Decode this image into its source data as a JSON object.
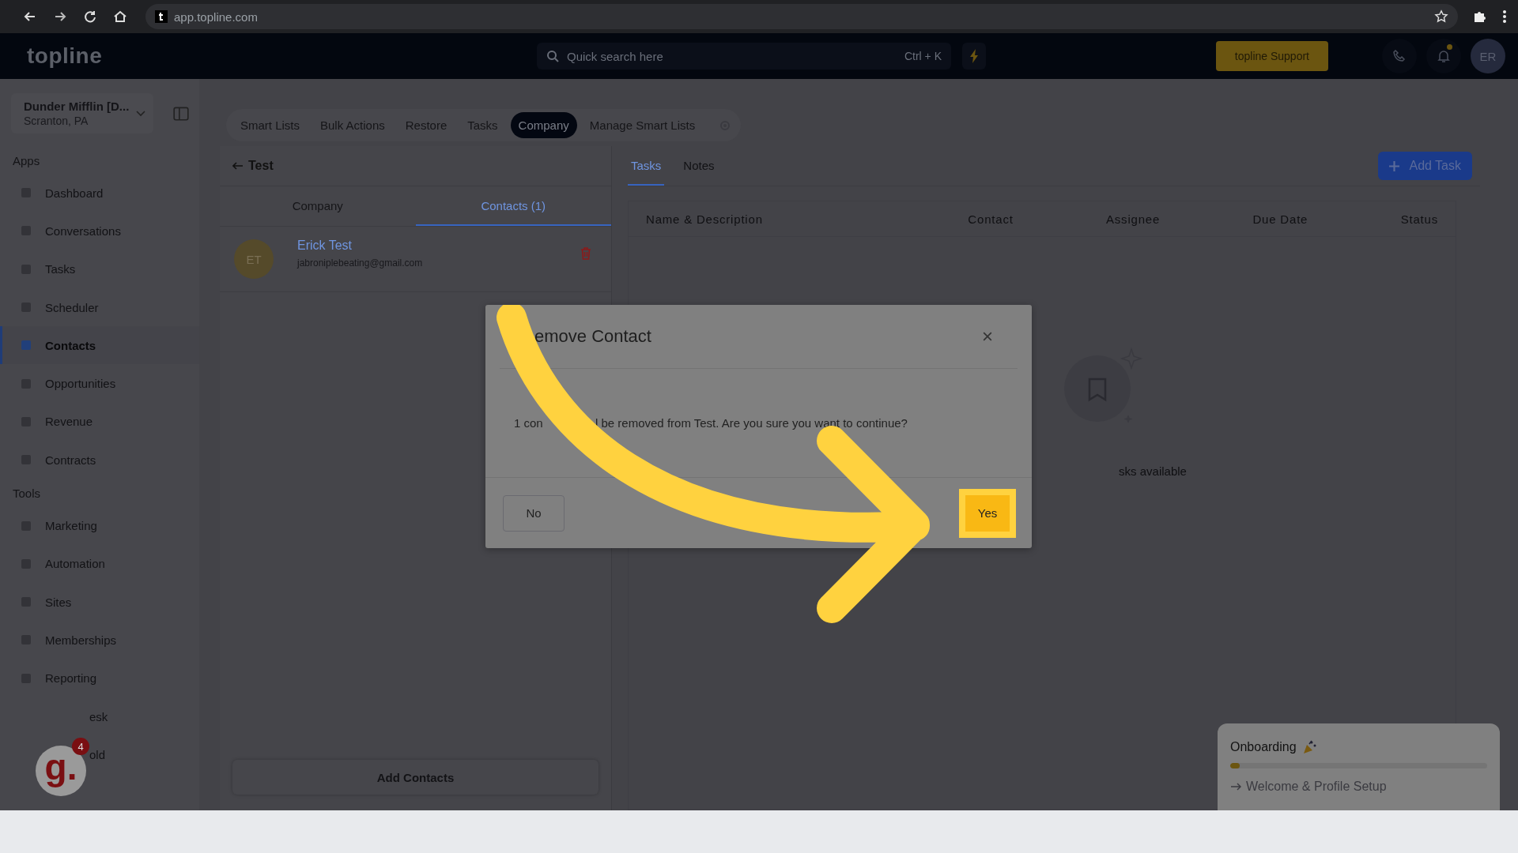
{
  "browser": {
    "url": "app.topline.com"
  },
  "header": {
    "logo": "topline",
    "search": {
      "placeholder": "Quick search here",
      "shortcut": "Ctrl + K"
    },
    "support_button": "topline Support",
    "avatar": "ER",
    "notification": true
  },
  "sidebar": {
    "account": {
      "name": "Dunder Mifflin [D...",
      "location": "Scranton, PA"
    },
    "sections": [
      {
        "title": "Apps",
        "items": [
          {
            "label": "Dashboard",
            "selected": false
          },
          {
            "label": "Conversations",
            "selected": false
          },
          {
            "label": "Tasks",
            "selected": false
          },
          {
            "label": "Scheduler",
            "selected": false
          },
          {
            "label": "Contacts",
            "selected": true
          },
          {
            "label": "Opportunities",
            "selected": false
          },
          {
            "label": "Revenue",
            "selected": false
          },
          {
            "label": "Contracts",
            "selected": false
          }
        ]
      },
      {
        "title": "Tools",
        "items": [
          {
            "label": "Marketing",
            "selected": false
          },
          {
            "label": "Automation",
            "selected": false
          },
          {
            "label": "Sites",
            "selected": false
          },
          {
            "label": "Memberships",
            "selected": false
          },
          {
            "label": "Reporting",
            "selected": false
          },
          {
            "label": "esk",
            "selected": false,
            "covered": true
          },
          {
            "label": "old",
            "selected": false,
            "covered": true
          }
        ]
      }
    ]
  },
  "top_tabs": [
    {
      "label": "Smart Lists",
      "selected": false
    },
    {
      "label": "Bulk Actions",
      "selected": false
    },
    {
      "label": "Restore",
      "selected": false
    },
    {
      "label": "Tasks",
      "selected": false
    },
    {
      "label": "Company",
      "selected": true
    },
    {
      "label": "Manage Smart Lists",
      "selected": false
    }
  ],
  "company_panel": {
    "back_label": "Test",
    "tabs": [
      {
        "label": "Company",
        "selected": false
      },
      {
        "label": "Contacts (1)",
        "selected": true
      }
    ],
    "contacts": [
      {
        "initials": "ET",
        "name": "Erick Test",
        "email": "jabroniplebeating@gmail.com"
      }
    ],
    "add_button": "Add Contacts"
  },
  "tasks_panel": {
    "tabs": [
      {
        "label": "Tasks",
        "selected": true
      },
      {
        "label": "Notes",
        "selected": false
      }
    ],
    "add_button": "Add Task",
    "columns": [
      "Name & Description",
      "Contact",
      "Assignee",
      "Due Date",
      "Status"
    ],
    "empty_text": "sks available"
  },
  "dialog": {
    "title": "emove Contact",
    "message_start": "1 con",
    "message_rest": "l be removed from Test. Are you sure you want to continue?",
    "buttons": [
      {
        "label": "No",
        "kind": "secondary"
      },
      {
        "label": "Yes",
        "kind": "primary"
      }
    ]
  },
  "onboarding": {
    "title": "Onboarding",
    "level": 0.03,
    "step": "Welcome & Profile Setup"
  },
  "widget": {
    "logo": "g.",
    "badge": "4"
  }
}
